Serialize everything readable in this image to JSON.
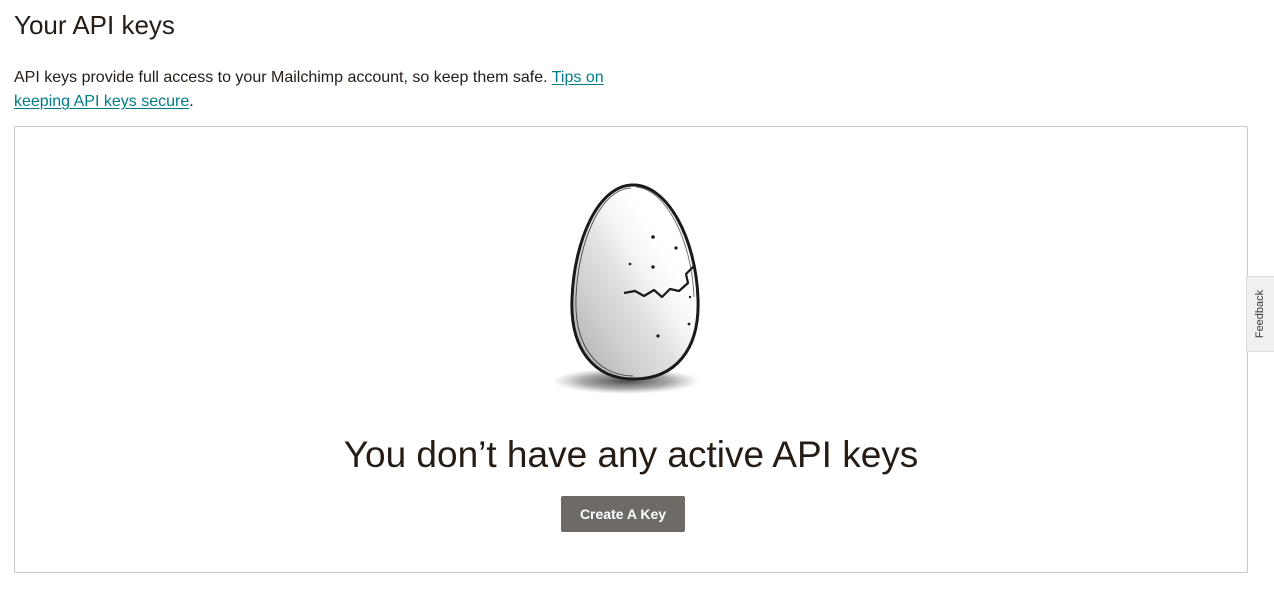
{
  "page": {
    "title": "Your API keys"
  },
  "intro": {
    "text": "API keys provide full access to your Mailchimp account, so keep them safe. ",
    "link_label": "Tips on keeping API keys secure",
    "trailing": "."
  },
  "empty_state": {
    "illustration": "cracked-egg-illustration",
    "heading": "You don’t have any active API keys",
    "button_label": "Create A Key"
  },
  "feedback": {
    "label": "Feedback"
  },
  "colors": {
    "link": "#007c89",
    "button": "#6e6a66",
    "text": "#241c15",
    "border": "#c8c8c8"
  }
}
